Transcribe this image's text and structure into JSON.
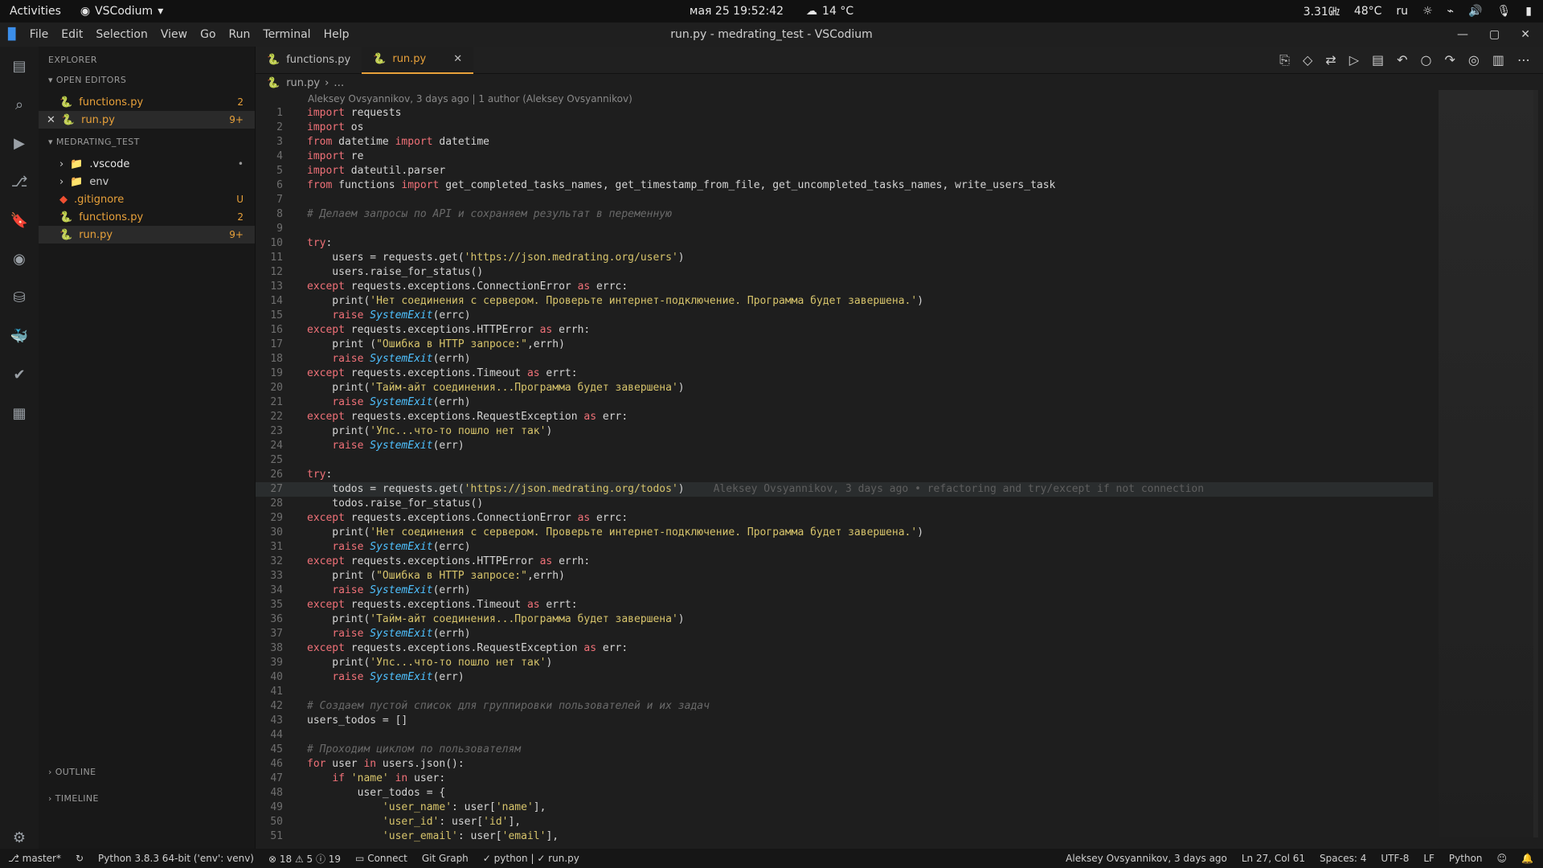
{
  "top": {
    "activities": "Activities",
    "app": "VSCodium",
    "datetime": "мая 25  19:52:42",
    "weather": "14 °C",
    "cpu": "3.31㎓",
    "temp": "48°C",
    "lang": "ru"
  },
  "menubar": {
    "items": [
      "File",
      "Edit",
      "Selection",
      "View",
      "Go",
      "Run",
      "Terminal",
      "Help"
    ],
    "title": "run.py - medrating_test - VSCodium"
  },
  "sidebar": {
    "explorer": "EXPLORER",
    "open_editors": "OPEN EDITORS",
    "open_editor_items": [
      {
        "name": "functions.py",
        "badge": "2"
      },
      {
        "name": "run.py",
        "badge": "9+",
        "active": true
      }
    ],
    "workspace": "MEDRATING_TEST",
    "tree": [
      {
        "name": ".vscode",
        "badge": "•"
      },
      {
        "name": "env",
        "badge": ""
      },
      {
        "name": ".gitignore",
        "badge": "U"
      },
      {
        "name": "functions.py",
        "badge": "2"
      },
      {
        "name": "run.py",
        "badge": "9+"
      }
    ],
    "outline": "OUTLINE",
    "timeline": "TIMELINE"
  },
  "tabs": [
    {
      "label": "functions.py",
      "active": false
    },
    {
      "label": "run.py",
      "active": true
    }
  ],
  "breadcrumbs": [
    "run.py",
    "…"
  ],
  "blame_header": "Aleksey Ovsyannikov, 3 days ago | 1 author (Aleksey Ovsyannikov)",
  "ghost_blame": "Aleksey Ovsyannikov, 3 days ago • refactoring and try/except if not connection",
  "code": [
    "import requests",
    "import os",
    "from datetime import datetime",
    "import re",
    "import dateutil.parser",
    "from functions import get_completed_tasks_names, get_timestamp_from_file, get_uncompleted_tasks_names, write_users_task",
    "",
    "# Делаем запросы по API и сохраняем результат в переменную",
    "",
    "try:",
    "    users = requests.get('https://json.medrating.org/users')",
    "    users.raise_for_status()",
    "except requests.exceptions.ConnectionError as errc:",
    "    print('Нет соединения с сервером. Проверьте интернет-подключение. Программа будет завершена.')",
    "    raise SystemExit(errc)",
    "except requests.exceptions.HTTPError as errh:",
    "    print (\"Ошибка в HTTP запросе:\",errh)",
    "    raise SystemExit(errh)",
    "except requests.exceptions.Timeout as errt:",
    "    print('Тайм-айт соединения...Программа будет завершена')",
    "    raise SystemExit(errh)",
    "except requests.exceptions.RequestException as err:",
    "    print('Упс...что-то пошло нет так')",
    "    raise SystemExit(err)",
    "",
    "try:",
    "    todos = requests.get('https://json.medrating.org/todos')",
    "    todos.raise_for_status()",
    "except requests.exceptions.ConnectionError as errc:",
    "    print('Нет соединения с сервером. Проверьте интернет-подключение. Программа будет завершена.')",
    "    raise SystemExit(errc)",
    "except requests.exceptions.HTTPError as errh:",
    "    print (\"Ошибка в HTTP запросе:\",errh)",
    "    raise SystemExit(errh)",
    "except requests.exceptions.Timeout as errt:",
    "    print('Тайм-айт соединения...Программа будет завершена')",
    "    raise SystemExit(errh)",
    "except requests.exceptions.RequestException as err:",
    "    print('Упс...что-то пошло нет так')",
    "    raise SystemExit(err)",
    "",
    "# Создаем пустой список для группировки пользователей и их задач",
    "users_todos = []",
    "",
    "# Проходим циклом по пользователям",
    "for user in users.json():",
    "    if 'name' in user:",
    "        user_todos = {",
    "            'user_name': user['name'],",
    "            'user_id': user['id'],",
    "            'user_email': user['email'],"
  ],
  "status": {
    "branch": "master*",
    "python": "Python 3.8.3 64-bit ('env': venv)",
    "problems": "⊗ 18 ⚠ 5 ⓘ 19",
    "connect": "Connect",
    "git_graph": "Git Graph",
    "check": "✓ python | ✓ run.py",
    "blame": "Aleksey Ovsyannikov, 3 days ago",
    "position": "Ln 27, Col 61",
    "spaces": "Spaces: 4",
    "encoding": "UTF-8",
    "eol": "LF",
    "lang": "Python"
  }
}
